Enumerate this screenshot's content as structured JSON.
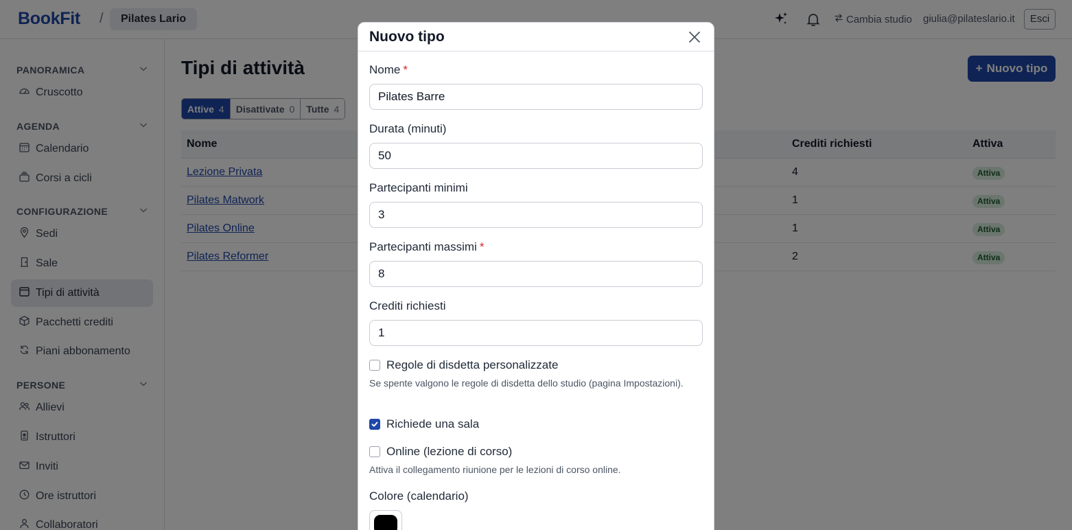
{
  "topbar": {
    "logo": "BookFit",
    "separator": "/",
    "studio": "Pilates Lario",
    "switch_studio": "Cambia studio",
    "user_email": "giulia@pilateslario.it",
    "logout": "Esci"
  },
  "sidebar": {
    "sections": [
      {
        "title": "PANORAMICA",
        "items": [
          {
            "label": "Cruscotto",
            "icon": "dashboard-icon"
          }
        ]
      },
      {
        "title": "AGENDA",
        "items": [
          {
            "label": "Calendario",
            "icon": "calendar-icon"
          },
          {
            "label": "Corsi a cicli",
            "icon": "stack-icon"
          }
        ]
      },
      {
        "title": "CONFIGURAZIONE",
        "items": [
          {
            "label": "Sedi",
            "icon": "map-pin-icon"
          },
          {
            "label": "Sale",
            "icon": "door-icon"
          },
          {
            "label": "Tipi di attività",
            "icon": "window-icon",
            "active": true
          },
          {
            "label": "Pacchetti crediti",
            "icon": "package-icon"
          },
          {
            "label": "Piani abbonamento",
            "icon": "refresh-icon"
          }
        ]
      },
      {
        "title": "PERSONE",
        "items": [
          {
            "label": "Allievi",
            "icon": "users-icon"
          },
          {
            "label": "Istruttori",
            "icon": "badge-icon"
          },
          {
            "label": "Inviti",
            "icon": "mail-icon"
          },
          {
            "label": "Ore istruttori",
            "icon": "clock-icon"
          },
          {
            "label": "Collaboratori",
            "icon": "user-icon"
          }
        ]
      }
    ]
  },
  "main": {
    "title": "Tipi di attività",
    "new_button": "Nuovo tipo",
    "filters": [
      {
        "label": "Attive",
        "count": "4",
        "selected": true
      },
      {
        "label": "Disattivate",
        "count": "0"
      },
      {
        "label": "Tutte",
        "count": "4"
      }
    ],
    "columns": {
      "name": "Nome",
      "credits": "Crediti richiesti",
      "active": "Attiva"
    },
    "rows": [
      {
        "name": "Lezione Privata",
        "credits": "4",
        "status": "Attiva"
      },
      {
        "name": "Pilates Matwork",
        "credits": "1",
        "status": "Attiva"
      },
      {
        "name": "Pilates Online",
        "credits": "1",
        "status": "Attiva"
      },
      {
        "name": "Pilates Reformer",
        "credits": "2",
        "status": "Attiva"
      }
    ]
  },
  "modal": {
    "title": "Nuovo tipo",
    "fields": {
      "name": {
        "label": "Nome",
        "value": "Pilates Barre",
        "required": true
      },
      "duration": {
        "label": "Durata (minuti)",
        "value": "50"
      },
      "min_participants": {
        "label": "Partecipanti minimi",
        "value": "3"
      },
      "max_participants": {
        "label": "Partecipanti massimi",
        "value": "8",
        "required": true
      },
      "credits": {
        "label": "Crediti richiesti",
        "value": "1"
      }
    },
    "custom_cancel": {
      "label": "Regole di disdetta personalizzate",
      "checked": false,
      "hint": "Se spente valgono le regole di disdetta dello studio (pagina Impostazioni)."
    },
    "requires_room": {
      "label": "Richiede una sala",
      "checked": true
    },
    "online": {
      "label": "Online (lezione di corso)",
      "checked": false,
      "hint": "Attiva il collegamento riunione per le lezioni di corso online."
    },
    "color": {
      "label": "Colore (calendario)",
      "value": "#000000"
    },
    "required_mark": "*"
  },
  "colors": {
    "accent": "#1f47a8",
    "badge_bg": "#d7ecdc",
    "required": "#dc2626"
  }
}
